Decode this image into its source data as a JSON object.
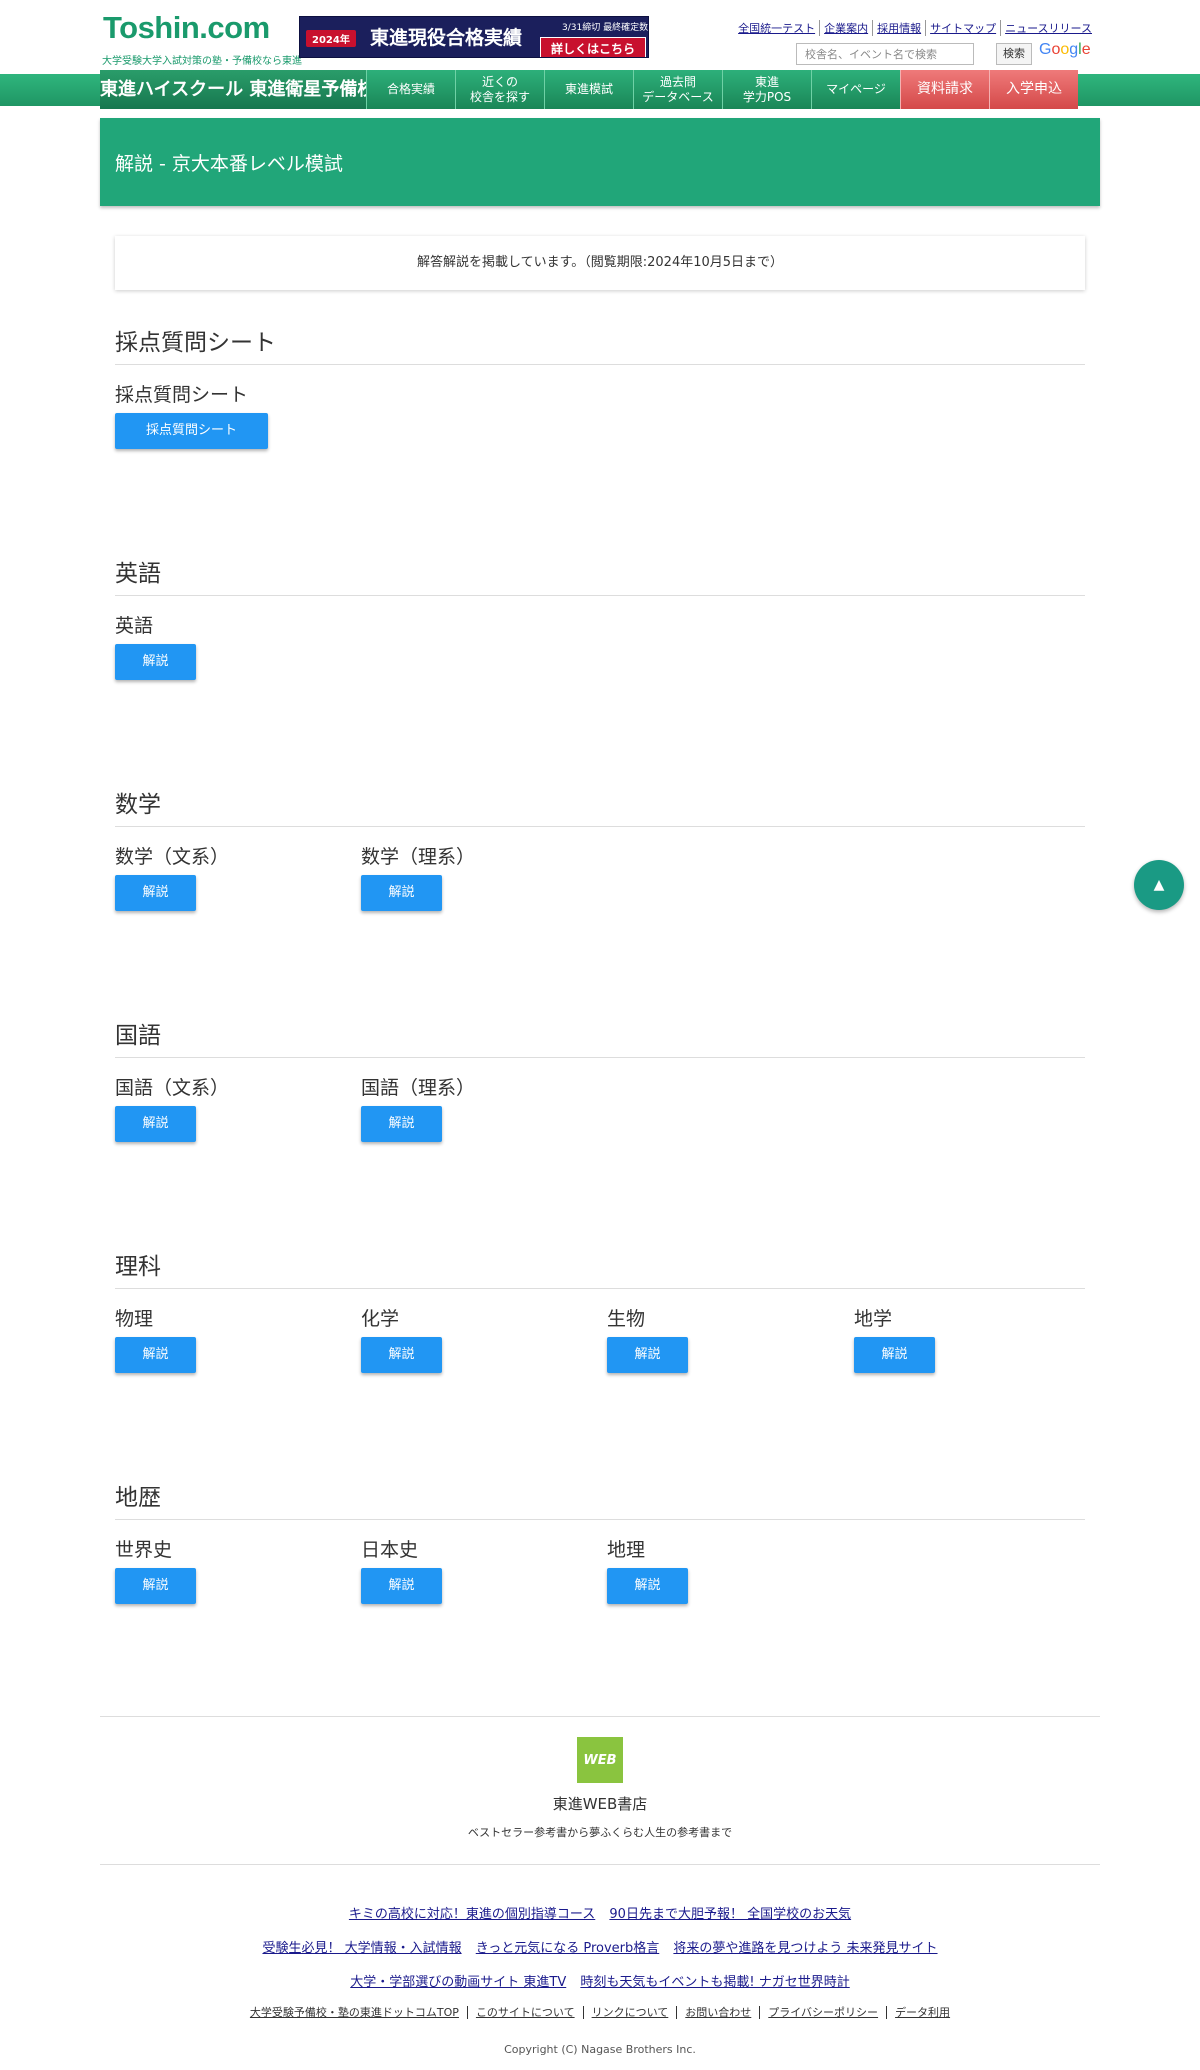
{
  "header": {
    "logo": "Toshin.com",
    "logo_sub": "大学受験大学入試対策の塾・予備校なら東進",
    "banner": {
      "year": "2024年",
      "main": "東進現役合格実績",
      "note": "3/31締切 最終確定数",
      "cta": "詳しくはこちら"
    },
    "top_links": [
      "全国統一テスト",
      "企業案内",
      "採用情報",
      "サイトマップ",
      "ニュースリリース"
    ],
    "search": {
      "placeholder": "校舎名、イベント名で検索",
      "button": "検索",
      "brand": "Google"
    }
  },
  "nav": {
    "brand": "東進ハイスクール 東進衛星予備校",
    "items": [
      {
        "label": "合格実績"
      },
      {
        "label": "近くの\n校舎を探す"
      },
      {
        "label": "東進模試"
      },
      {
        "label": "過去問\nデータベース"
      },
      {
        "label": "東進\n学力POS"
      },
      {
        "label": "マイページ"
      },
      {
        "label": "資料請求"
      },
      {
        "label": "入学申込"
      }
    ]
  },
  "main": {
    "title": "解説 - 京大本番レベル模試",
    "notice": "解答解説を掲載しています。（閲覧期限:2024年10月5日まで）",
    "sections": [
      {
        "title": "採点質問シート",
        "subs": [
          {
            "label": "採点質問シート",
            "button": "採点質問シート"
          }
        ]
      },
      {
        "title": "英語",
        "subs": [
          {
            "label": "英語",
            "button": "解説"
          }
        ]
      },
      {
        "title": "数学",
        "subs": [
          {
            "label": "数学（文系）",
            "button": "解説"
          },
          {
            "label": "数学（理系）",
            "button": "解説"
          }
        ]
      },
      {
        "title": "国語",
        "subs": [
          {
            "label": "国語（文系）",
            "button": "解説"
          },
          {
            "label": "国語（理系）",
            "button": "解説"
          }
        ]
      },
      {
        "title": "理科",
        "subs": [
          {
            "label": "物理",
            "button": "解説"
          },
          {
            "label": "化学",
            "button": "解説"
          },
          {
            "label": "生物",
            "button": "解説"
          },
          {
            "label": "地学",
            "button": "解説"
          }
        ]
      },
      {
        "title": "地歴",
        "subs": [
          {
            "label": "世界史",
            "button": "解説"
          },
          {
            "label": "日本史",
            "button": "解説"
          },
          {
            "label": "地理",
            "button": "解説"
          }
        ]
      }
    ]
  },
  "footer": {
    "web_icon": "WEB",
    "web_title": "東進WEB書店",
    "web_sub": "ベストセラー参考書から夢ふくらむ人生の参考書まで",
    "link_rows": [
      [
        "キミの高校に対応！東進の個別指導コース",
        "90日先まで大胆予報！ 全国学校のお天気"
      ],
      [
        "受験生必見！ 大学情報・入試情報",
        "きっと元気になる Proverb格言",
        "将来の夢や進路を見つけよう 未来発見サイト"
      ],
      [
        "大学・学部選びの動画サイト 東進TV",
        "時刻も天気もイベントも掲載! ナガセ世界時計"
      ]
    ],
    "small_links": [
      "大学受験予備校・塾の東進ドットコムTOP",
      "このサイトについて",
      "リンクについて",
      "お問い合わせ",
      "プライバシーポリシー",
      "データ利用"
    ],
    "copyright": "Copyright (C) Nagase Brothers Inc."
  }
}
